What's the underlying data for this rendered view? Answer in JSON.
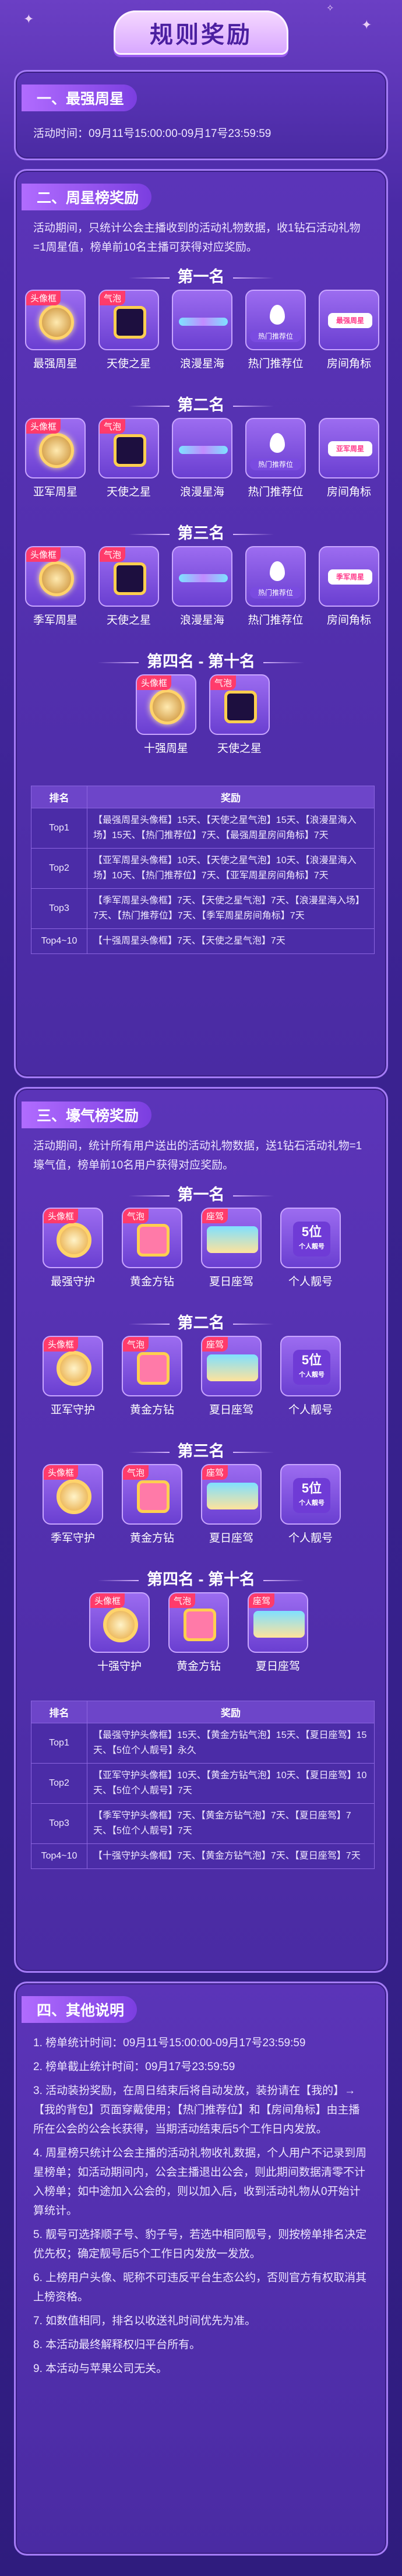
{
  "page_title": "规则奖励",
  "section1": {
    "heading": "一、最强周星",
    "activity_time": "活动时间：09月11号15:00:00-09月17号23:59:59"
  },
  "section2": {
    "heading": "二、周星榜奖励",
    "desc": "活动期间，只统计公会主播收到的活动礼物数据，收1钻石活动礼物=1周星值，榜单前10名主播可获得对应奖励。",
    "ranks": [
      {
        "title": "第一名",
        "items": [
          {
            "tag": "头像框",
            "caption": "最强周星"
          },
          {
            "tag": "气泡",
            "caption": "天使之星"
          },
          {
            "tag": "",
            "caption": "浪漫星海"
          },
          {
            "tag": "",
            "caption": "热门推荐位",
            "inner": "热门推荐位"
          },
          {
            "tag": "",
            "caption": "房间角标",
            "inner": "最强周星"
          }
        ]
      },
      {
        "title": "第二名",
        "items": [
          {
            "tag": "头像框",
            "caption": "亚军周星"
          },
          {
            "tag": "气泡",
            "caption": "天使之星"
          },
          {
            "tag": "",
            "caption": "浪漫星海"
          },
          {
            "tag": "",
            "caption": "热门推荐位",
            "inner": "热门推荐位"
          },
          {
            "tag": "",
            "caption": "房间角标",
            "inner": "亚军周星"
          }
        ]
      },
      {
        "title": "第三名",
        "items": [
          {
            "tag": "头像框",
            "caption": "季军周星"
          },
          {
            "tag": "气泡",
            "caption": "天使之星"
          },
          {
            "tag": "",
            "caption": "浪漫星海"
          },
          {
            "tag": "",
            "caption": "热门推荐位",
            "inner": "热门推荐位"
          },
          {
            "tag": "",
            "caption": "房间角标",
            "inner": "季军周星"
          }
        ]
      },
      {
        "title": "第四名 - 第十名",
        "items": [
          {
            "tag": "头像框",
            "caption": "十强周星"
          },
          {
            "tag": "气泡",
            "caption": "天使之星"
          }
        ]
      }
    ],
    "table": {
      "headers": [
        "排名",
        "奖励"
      ],
      "rows": [
        {
          "rank": "Top1",
          "reward": "【最强周星头像框】15天、【天使之星气泡】15天、【浪漫星海入场】15天、【热门推荐位】7天、【最强周星房间角标】7天"
        },
        {
          "rank": "Top2",
          "reward": "【亚军周星头像框】10天、【天使之星气泡】10天、【浪漫星海入场】10天、【热门推荐位】7天、【亚军周星房间角标】7天"
        },
        {
          "rank": "Top3",
          "reward": "【季军周星头像框】7天、【天使之星气泡】7天、【浪漫星海入场】7天、【热门推荐位】7天、【季军周星房间角标】7天"
        },
        {
          "rank": "Top4~10",
          "reward": "【十强周星头像框】7天、【天使之星气泡】7天"
        }
      ]
    }
  },
  "section3": {
    "heading": "三、壕气榜奖励",
    "desc": "活动期间，统计所有用户送出的活动礼物数据，送1钻石活动礼物=1壕气值，榜单前10名用户获得对应奖励。",
    "ranks": [
      {
        "title": "第一名",
        "items": [
          {
            "tag": "头像框",
            "caption": "最强守护"
          },
          {
            "tag": "气泡",
            "caption": "黄金方钻"
          },
          {
            "tag": "座驾",
            "caption": "夏日座驾"
          },
          {
            "tag": "",
            "caption": "个人靓号",
            "inner": "5位",
            "inner2": "个人靓号"
          }
        ]
      },
      {
        "title": "第二名",
        "items": [
          {
            "tag": "头像框",
            "caption": "亚军守护"
          },
          {
            "tag": "气泡",
            "caption": "黄金方钻"
          },
          {
            "tag": "座驾",
            "caption": "夏日座驾"
          },
          {
            "tag": "",
            "caption": "个人靓号",
            "inner": "5位",
            "inner2": "个人靓号"
          }
        ]
      },
      {
        "title": "第三名",
        "items": [
          {
            "tag": "头像框",
            "caption": "季军守护"
          },
          {
            "tag": "气泡",
            "caption": "黄金方钻"
          },
          {
            "tag": "座驾",
            "caption": "夏日座驾"
          },
          {
            "tag": "",
            "caption": "个人靓号",
            "inner": "5位",
            "inner2": "个人靓号"
          }
        ]
      },
      {
        "title": "第四名 - 第十名",
        "items": [
          {
            "tag": "头像框",
            "caption": "十强守护"
          },
          {
            "tag": "气泡",
            "caption": "黄金方钻"
          },
          {
            "tag": "座驾",
            "caption": "夏日座驾"
          }
        ]
      }
    ],
    "table": {
      "headers": [
        "排名",
        "奖励"
      ],
      "rows": [
        {
          "rank": "Top1",
          "reward": "【最强守护头像框】15天、【黄金方钻气泡】15天、【夏日座驾】15天、【5位个人靓号】永久"
        },
        {
          "rank": "Top2",
          "reward": "【亚军守护头像框】10天、【黄金方钻气泡】10天、【夏日座驾】10天、【5位个人靓号】7天"
        },
        {
          "rank": "Top3",
          "reward": "【季军守护头像框】7天、【黄金方钻气泡】7天、【夏日座驾】7天、【5位个人靓号】7天"
        },
        {
          "rank": "Top4~10",
          "reward": "【十强守护头像框】7天、【黄金方钻气泡】7天、【夏日座驾】7天"
        }
      ]
    }
  },
  "section4": {
    "heading": "四、其他说明",
    "notes": [
      "1. 榜单统计时间：09月11号15:00:00-09月17号23:59:59",
      "2. 榜单截止统计时间：09月17号23:59:59",
      "3. 活动装扮奖励，在周日结束后将自动发放，装扮请在【我的】→【我的背包】页面穿戴使用；【热门推荐位】和【房间角标】由主播所在公会的公会长获得，当期活动结束后5个工作日内发放。",
      "4. 周星榜只统计公会主播的活动礼物收礼数据，个人用户不记录到周星榜单；如活动期间内，公会主播退出公会，则此期间数据清零不计入榜单；如中途加入公会的，则以加入后，收到活动礼物从0开始计算统计。",
      "5. 靓号可选择顺子号、豹子号，若选中相同靓号，则按榜单排名决定优先权；确定靓号后5个工作日内发放一发放。",
      "6. 上榜用户头像、昵称不可违反平台生态公约，否则官方有权取消其上榜资格。",
      "7. 如数值相同，排名以收送礼时间优先为准。",
      "8. 本活动最终解释权归平台所有。",
      "9. 本活动与苹果公司无关。"
    ]
  }
}
